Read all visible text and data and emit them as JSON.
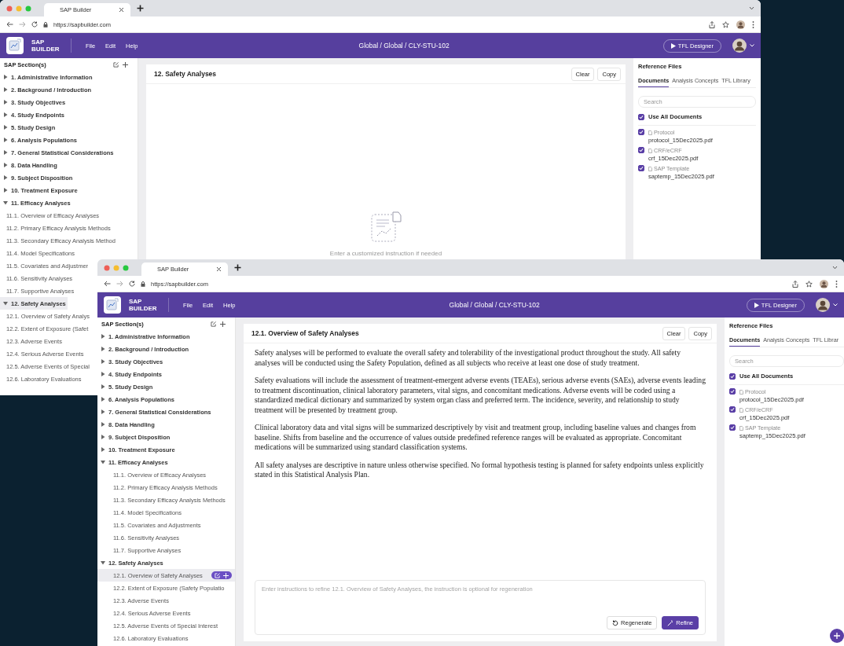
{
  "windows": [
    {
      "tab_title": "SAP Builder",
      "url": "https://sapbuilder.com",
      "app": {
        "logo_text": "SAP BUILDER",
        "menus": [
          "File",
          "Edit",
          "Help"
        ],
        "breadcrumb": "Global / Global / CLY-STU-102",
        "primary_button": "TFL Designer"
      },
      "sidebar": {
        "title": "SAP Section(s)",
        "items": [
          {
            "label": "1. Administrative Information",
            "expanded": false,
            "selected": false
          },
          {
            "label": "2. Background / Introduction",
            "expanded": false,
            "selected": false
          },
          {
            "label": "3. Study Objectives",
            "expanded": false,
            "selected": false
          },
          {
            "label": "4. Study Endpoints",
            "expanded": false,
            "selected": false
          },
          {
            "label": "5. Study Design",
            "expanded": false,
            "selected": false
          },
          {
            "label": "6. Analysis Populations",
            "expanded": false,
            "selected": false
          },
          {
            "label": "7. General Statistical Considerations",
            "expanded": false,
            "selected": false
          },
          {
            "label": "8. Data Handling",
            "expanded": false,
            "selected": false
          },
          {
            "label": "9. Subject Disposition",
            "expanded": false,
            "selected": false
          },
          {
            "label": "10. Treatment Exposure",
            "expanded": false,
            "selected": false
          },
          {
            "label": "11. Efficacy Analyses",
            "expanded": true,
            "selected": false,
            "children": [
              {
                "label": "11.1. Overview of Efficacy Analyses",
                "selected": false
              },
              {
                "label": "11.2. Primary Efficacy Analysis Methods",
                "selected": false
              },
              {
                "label": "11.3. Secondary Efficacy Analysis Method",
                "selected": false
              },
              {
                "label": "11.4. Model Specifications",
                "selected": false
              },
              {
                "label": "11.5. Covariates and Adjustmer",
                "selected": false
              },
              {
                "label": "11.6. Sensitivity Analyses",
                "selected": false
              },
              {
                "label": "11.7. Supportive Analyses",
                "selected": false
              }
            ]
          },
          {
            "label": "12. Safety Analyses",
            "expanded": true,
            "selected": true,
            "children": [
              {
                "label": "12.1. Overview of Safety Analys",
                "selected": false
              },
              {
                "label": "12.2. Extent of Exposure (Safet",
                "selected": false
              },
              {
                "label": "12.3. Adverse Events",
                "selected": false
              },
              {
                "label": "12.4. Serious Adverse Events",
                "selected": false
              },
              {
                "label": "12.5. Adverse Events of Special",
                "selected": false
              },
              {
                "label": "12.6. Laboratory Evaluations",
                "selected": false
              }
            ]
          }
        ]
      },
      "editor": {
        "title": "12. Safety Analyses",
        "buttons": [
          "Clear",
          "Copy"
        ],
        "kind": "empty",
        "hint": "Enter a customized instruction if needed"
      },
      "reference": {
        "title": "Reference Files",
        "tabs": [
          {
            "label": "Documents",
            "selected": true
          },
          {
            "label": "Analysis Concepts",
            "selected": false
          },
          {
            "label": "TFL Library",
            "selected": false
          }
        ],
        "search": {
          "placeholder": "Search"
        },
        "use_all": {
          "label": "Use All Documents",
          "checked": true
        },
        "documents": [
          {
            "type": "Protocol",
            "file": "protocol_15Dec2025.pdf",
            "checked": true
          },
          {
            "type": "CRF/eCRF",
            "file": "crf_15Dec2025.pdf",
            "checked": true
          },
          {
            "type": "SAP Template",
            "file": "saptemp_15Dec2025.pdf",
            "checked": true
          }
        ]
      }
    },
    {
      "tab_title": "SAP Builder",
      "url": "https://sapbuilder.com",
      "app": {
        "logo_text": "SAP BUILDER",
        "menus": [
          "File",
          "Edit",
          "Help"
        ],
        "breadcrumb": "Global / Global / CLY-STU-102",
        "primary_button": "TFL Designer"
      },
      "sidebar": {
        "title": "SAP Section(s)",
        "items": [
          {
            "label": "1. Administrative Information",
            "expanded": false,
            "selected": false
          },
          {
            "label": "2. Background / Introduction",
            "expanded": false,
            "selected": false
          },
          {
            "label": "3. Study Objectives",
            "expanded": false,
            "selected": false
          },
          {
            "label": "4. Study Endpoints",
            "expanded": false,
            "selected": false
          },
          {
            "label": "5. Study Design",
            "expanded": false,
            "selected": false
          },
          {
            "label": "6. Analysis Populations",
            "expanded": false,
            "selected": false
          },
          {
            "label": "7. General Statistical Considerations",
            "expanded": false,
            "selected": false
          },
          {
            "label": "8. Data Handling",
            "expanded": false,
            "selected": false
          },
          {
            "label": "9. Subject Disposition",
            "expanded": false,
            "selected": false
          },
          {
            "label": "10. Treatment Exposure",
            "expanded": false,
            "selected": false
          },
          {
            "label": "11. Efficacy Analyses",
            "expanded": true,
            "selected": false,
            "children": [
              {
                "label": "11.1. Overview of Efficacy Analyses",
                "selected": false
              },
              {
                "label": "11.2. Primary Efficacy Analysis Methods",
                "selected": false
              },
              {
                "label": "11.3. Secondary Efficacy Analysis Methods",
                "selected": false
              },
              {
                "label": "11.4. Model Specifications",
                "selected": false
              },
              {
                "label": "11.5. Covariates and Adjustments",
                "selected": false
              },
              {
                "label": "11.6. Sensitivity Analyses",
                "selected": false
              },
              {
                "label": "11.7. Supportive Analyses",
                "selected": false
              }
            ]
          },
          {
            "label": "12. Safety Analyses",
            "expanded": true,
            "selected": false,
            "children": [
              {
                "label": "12.1. Overview of Safety Analyses",
                "selected": true
              },
              {
                "label": "12.2. Extent of Exposure (Safety Populatio",
                "selected": false
              },
              {
                "label": "12.3. Adverse Events",
                "selected": false
              },
              {
                "label": "12.4. Serious Adverse Events",
                "selected": false
              },
              {
                "label": "12.5. Adverse Events of Special Interest",
                "selected": false
              },
              {
                "label": "12.6. Laboratory Evaluations",
                "selected": false
              }
            ]
          }
        ]
      },
      "editor": {
        "title": "12.1. Overview of Safety Analyses",
        "buttons": [
          "Clear",
          "Copy"
        ],
        "kind": "document",
        "paragraphs": [
          "Safety analyses will be performed to evaluate the overall safety and tolerability of the investigational product throughout the study. All safety analyses will be conducted using the Safety Population, defined as all subjects who receive at least one dose of study treatment.",
          "Safety evaluations will include the assessment of treatment-emergent adverse events (TEAEs), serious adverse events (SAEs), adverse events leading to treatment discontinuation, clinical laboratory parameters, vital signs, and concomitant medications. Adverse events will be coded using a standardized medical dictionary and summarized by system organ class and preferred term. The incidence, severity, and relationship to study treatment will be presented by treatment group.",
          "Clinical laboratory data and vital signs will be summarized descriptively by visit and treatment group, including baseline values and changes from baseline. Shifts from baseline and the occurrence of values outside predefined reference ranges will be evaluated as appropriate. Concomitant medications will be summarized using standard classification systems.",
          "All safety analyses are descriptive in nature unless otherwise specified. No formal hypothesis testing is planned for safety endpoints unless explicitly stated in this Statistical Analysis Plan."
        ],
        "instruction": {
          "placeholder": "Enter instructions to refine 12.1. Overview of Safety Analyses, the instruction is optional for regeneration"
        },
        "actions": [
          {
            "label": "Regenerate",
            "kind": "secondary"
          },
          {
            "label": "Refine",
            "kind": "primary"
          }
        ]
      },
      "reference": {
        "title": "Reference Files",
        "tabs": [
          {
            "label": "Documents",
            "selected": true
          },
          {
            "label": "Analysis Concepts",
            "selected": false
          },
          {
            "label": "TFL Librar",
            "selected": false
          }
        ],
        "search": {
          "placeholder": "Search"
        },
        "use_all": {
          "label": "Use All Documents",
          "checked": true
        },
        "documents": [
          {
            "type": "Protocol",
            "file": "protocol_15Dec2025.pdf",
            "checked": true
          },
          {
            "type": "CRF/eCRF",
            "file": "crf_15Dec2025.pdf",
            "checked": true
          },
          {
            "type": "SAP Template",
            "file": "saptemp_15Dec2025.pdf",
            "checked": true
          }
        ]
      }
    }
  ]
}
